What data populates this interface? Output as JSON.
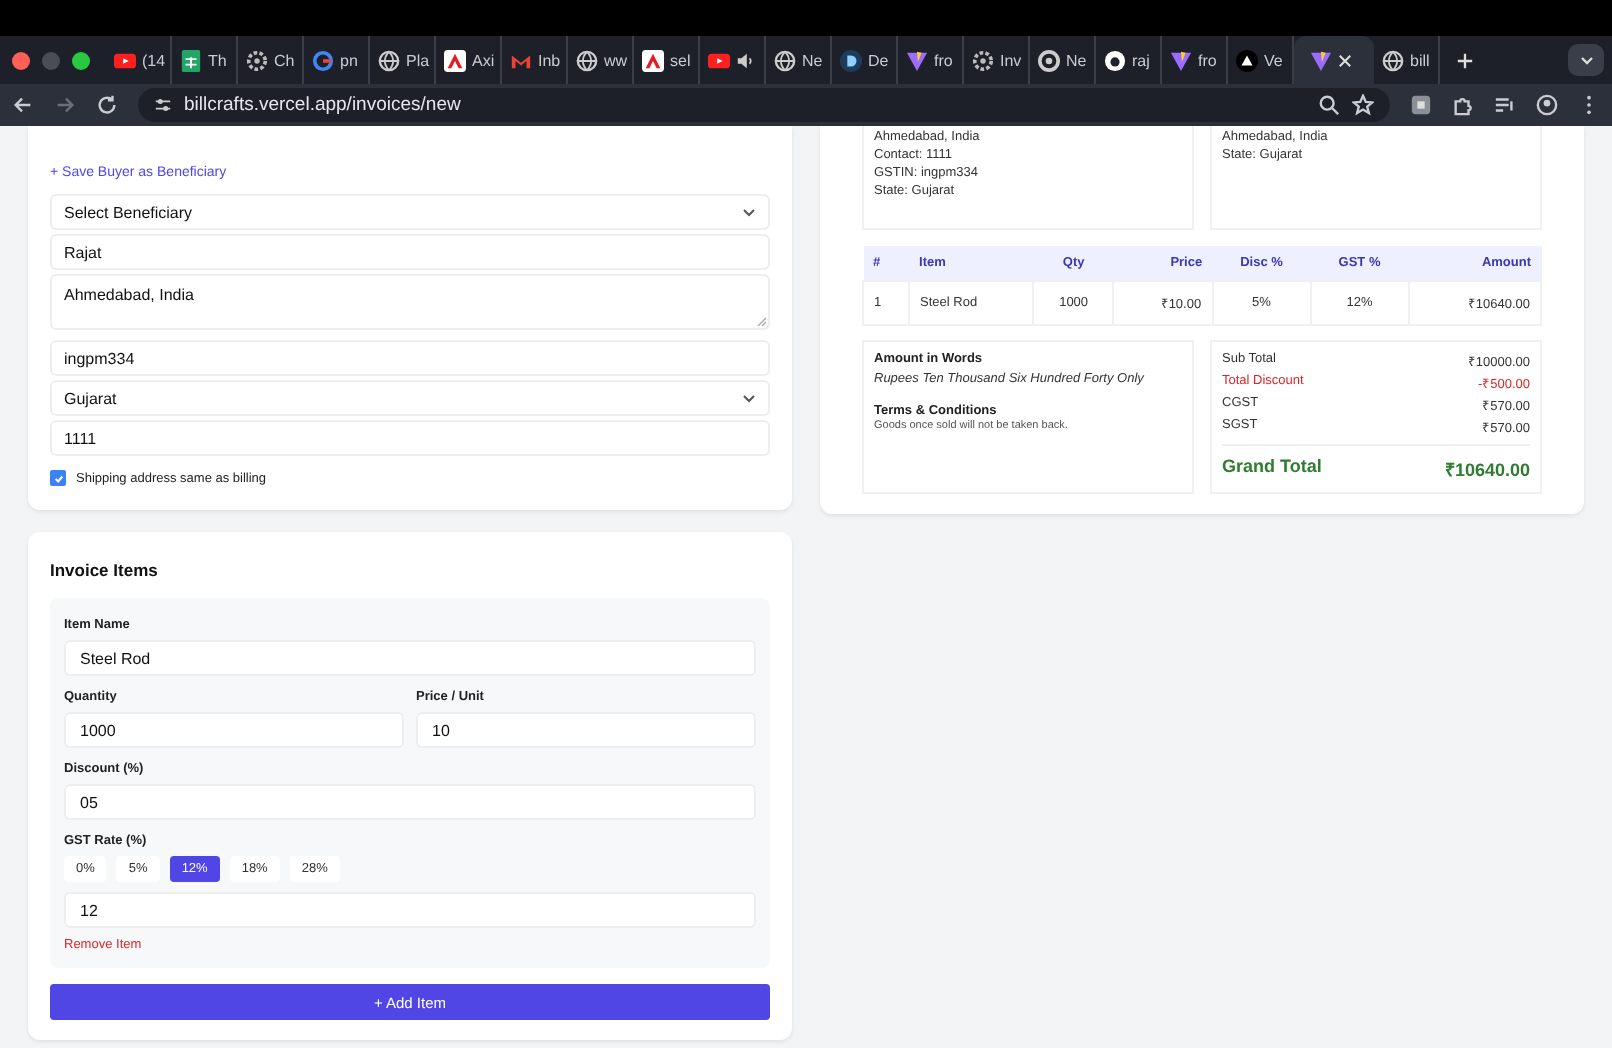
{
  "browser": {
    "tabs": [
      {
        "kind": "youtube",
        "title": "(14",
        "audio": false,
        "selected": false
      },
      {
        "kind": "sheets",
        "title": "Th",
        "audio": false,
        "selected": false
      },
      {
        "kind": "gear",
        "title": "Ch",
        "audio": false,
        "selected": false
      },
      {
        "kind": "google",
        "title": "pn",
        "audio": false,
        "selected": false
      },
      {
        "kind": "globe",
        "title": "Pla",
        "audio": false,
        "selected": false
      },
      {
        "kind": "adobe",
        "title": "Axi",
        "audio": false,
        "selected": false
      },
      {
        "kind": "gmail",
        "title": "Inb",
        "audio": false,
        "selected": false
      },
      {
        "kind": "globe",
        "title": "ww",
        "audio": false,
        "selected": false
      },
      {
        "kind": "adobe",
        "title": "sel",
        "audio": false,
        "selected": false
      },
      {
        "kind": "youtube",
        "audio": true,
        "selected": false
      },
      {
        "kind": "globe",
        "title": "Ne",
        "audio": false,
        "selected": false
      },
      {
        "kind": "letter",
        "title": "De",
        "audio": false,
        "selected": false
      },
      {
        "kind": "vite",
        "title": "fro",
        "audio": false,
        "selected": false
      },
      {
        "kind": "gear",
        "title": "Inv",
        "audio": false,
        "selected": false
      },
      {
        "kind": "chrome",
        "title": "Ne",
        "audio": false,
        "selected": false
      },
      {
        "kind": "github",
        "title": "raj",
        "audio": false,
        "selected": false
      },
      {
        "kind": "vite",
        "title": "fro",
        "audio": false,
        "selected": false
      },
      {
        "kind": "vercel",
        "title": "Ve",
        "audio": false,
        "selected": false
      },
      {
        "kind": "vite",
        "audio": false,
        "selected": true
      },
      {
        "kind": "globe",
        "title": "bill",
        "audio": false,
        "selected": false
      }
    ],
    "url": "billcrafts.vercel.app/invoices/new"
  },
  "buyer_form": {
    "save_link": "+ Save Buyer as Beneficiary",
    "fields": [
      {
        "kind": "select",
        "value": "Select Beneficiary"
      },
      {
        "kind": "input",
        "value": "Rajat"
      },
      {
        "kind": "textarea",
        "value": "Ahmedabad, India"
      },
      {
        "kind": "input",
        "value": "ingpm334"
      },
      {
        "kind": "select",
        "value": "Gujarat"
      },
      {
        "kind": "input",
        "value": "1111"
      }
    ],
    "same_shipping": {
      "label": "Shipping address same as billing",
      "checked": true
    }
  },
  "preview": {
    "billing_lines": [
      "Ahmedabad, India",
      "Contact: 1111",
      "GSTIN: ingpm334",
      "State: Gujarat"
    ],
    "shipping_lines": [
      "Ahmedabad, India",
      "State: Gujarat"
    ],
    "table": {
      "columns": [
        "#",
        "Item",
        "Qty",
        "Price",
        "Disc %",
        "GST %",
        "Amount"
      ],
      "rows": [
        [
          "1",
          "Steel Rod",
          "1000",
          "₹10.00",
          "5%",
          "12%",
          "₹10640.00"
        ]
      ]
    },
    "words_title": "Amount in Words",
    "words": "Rupees Ten Thousand Six Hundred Forty Only",
    "terms_title": "Terms & Conditions",
    "terms": "Goods once sold will not be taken back.",
    "totals": [
      {
        "label": "Sub Total",
        "value": "₹10000.00",
        "kind": "normal"
      },
      {
        "label": "Total Discount",
        "value": "-₹500.00",
        "kind": "discount"
      },
      {
        "label": "CGST",
        "value": "₹570.00",
        "kind": "normal"
      },
      {
        "label": "SGST",
        "value": "₹570.00",
        "kind": "normal"
      }
    ],
    "grand_total": {
      "label": "Grand Total",
      "value": "₹10640.00"
    }
  },
  "items": {
    "title": "Invoice Items",
    "entries": [
      {
        "name_label": "Item Name",
        "name": "Steel Rod",
        "qty_label": "Quantity",
        "qty": "1000",
        "price_label": "Price / Unit",
        "price": "10",
        "discount_label": "Discount (%)",
        "discount": "05",
        "gst_label": "GST Rate (%)",
        "gst_options": [
          {
            "label": "0%",
            "selected": false
          },
          {
            "label": "5%",
            "selected": false
          },
          {
            "label": "12%",
            "selected": true
          },
          {
            "label": "18%",
            "selected": false
          },
          {
            "label": "28%",
            "selected": false
          }
        ],
        "gst": "12",
        "remove": "Remove Item"
      }
    ],
    "add_button": "+ Add Item"
  }
}
